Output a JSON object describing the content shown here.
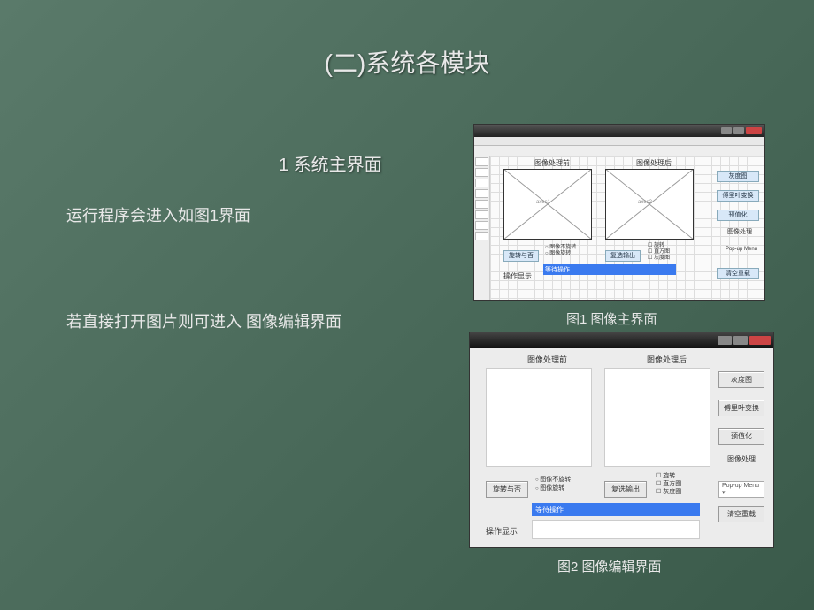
{
  "slide": {
    "title": "(二)系统各模块",
    "subtitle": "1 系统主界面",
    "body1": "运行程序会进入如图1界面",
    "body2": "若直接打开图片则可进入  图像编辑界面",
    "caption1": "图1 图像主界面",
    "caption2": "图2 图像编辑界面"
  },
  "app": {
    "panel_before": "图像处理前",
    "panel_after": "图像处理后",
    "axes1_tag": "axes1",
    "axes2_tag": "axes2",
    "btn_gray": "灰度图",
    "btn_fft": "傅里叶变换",
    "btn_threshold": "预值化",
    "section_imgproc": "图像处理",
    "btn_rotate": "旋转与否",
    "radio_norotate": "图像不旋转",
    "radio_rotate": "图像旋转",
    "btn_restore": "复选输出",
    "chk_rotate": "旋转",
    "chk_hist": "直方图",
    "chk_gray": "灰度图",
    "label_opdisplay": "操作显示",
    "wait_text": "等待操作",
    "btn_clear": "清空重载",
    "popup_label": "Pop-up Menu"
  }
}
